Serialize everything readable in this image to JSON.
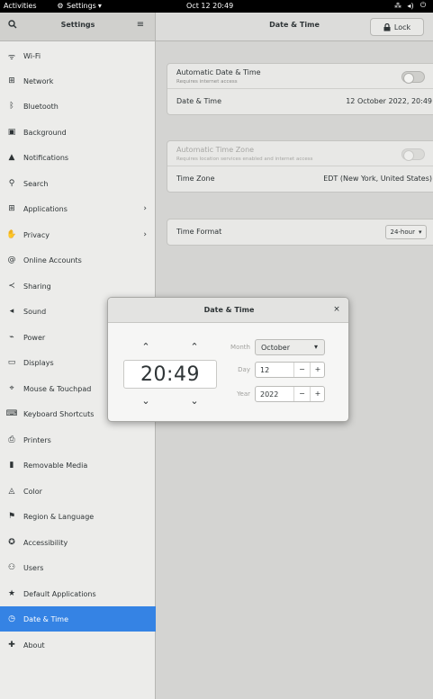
{
  "topbar": {
    "activities": "Activities",
    "app_menu": "Settings",
    "clock": "Oct 12  20:49"
  },
  "header": {
    "sidebar_title": "Settings",
    "page_title": "Date & Time",
    "lock_label": "Lock"
  },
  "sidebar": {
    "items": [
      {
        "label": "Wi-Fi",
        "icon": "wifi-icon"
      },
      {
        "label": "Network",
        "icon": "network-icon"
      },
      {
        "label": "Bluetooth",
        "icon": "bluetooth-icon"
      },
      {
        "label": "Background",
        "icon": "background-icon"
      },
      {
        "label": "Notifications",
        "icon": "bell-icon"
      },
      {
        "label": "Search",
        "icon": "search-icon"
      },
      {
        "label": "Applications",
        "icon": "apps-grid-icon",
        "has_submenu": true
      },
      {
        "label": "Privacy",
        "icon": "hand-icon",
        "has_submenu": true
      },
      {
        "label": "Online Accounts",
        "icon": "at-icon"
      },
      {
        "label": "Sharing",
        "icon": "share-icon"
      },
      {
        "label": "Sound",
        "icon": "speaker-icon"
      },
      {
        "label": "Power",
        "icon": "power-icon"
      },
      {
        "label": "Displays",
        "icon": "display-icon"
      },
      {
        "label": "Mouse & Touchpad",
        "icon": "mouse-icon"
      },
      {
        "label": "Keyboard Shortcuts",
        "icon": "keyboard-icon"
      },
      {
        "label": "Printers",
        "icon": "printer-icon"
      },
      {
        "label": "Removable Media",
        "icon": "usb-icon"
      },
      {
        "label": "Color",
        "icon": "color-icon"
      },
      {
        "label": "Region & Language",
        "icon": "flag-icon"
      },
      {
        "label": "Accessibility",
        "icon": "accessibility-icon"
      },
      {
        "label": "Users",
        "icon": "users-icon"
      },
      {
        "label": "Default Applications",
        "icon": "star-icon"
      },
      {
        "label": "Date & Time",
        "icon": "clock-icon",
        "selected": true
      },
      {
        "label": "About",
        "icon": "about-icon"
      }
    ]
  },
  "content": {
    "auto_datetime_label": "Automatic Date & Time",
    "auto_datetime_sub": "Requires internet access",
    "datetime_label": "Date & Time",
    "datetime_value": "12 October 2022, 20:49",
    "auto_tz_label": "Automatic Time Zone",
    "auto_tz_sub": "Requires location services enabled and internet access",
    "tz_label": "Time Zone",
    "tz_value": "EDT (New York, United States)",
    "time_format_label": "Time Format",
    "time_format_value": "24-hour"
  },
  "dialog": {
    "title": "Date & Time",
    "time": "20:49",
    "month_label": "Month",
    "month_value": "October",
    "day_label": "Day",
    "day_value": "12",
    "year_label": "Year",
    "year_value": "2022",
    "minus": "−",
    "plus": "+"
  },
  "colors": {
    "accent": "#3583e4",
    "topbar": "#000000"
  }
}
